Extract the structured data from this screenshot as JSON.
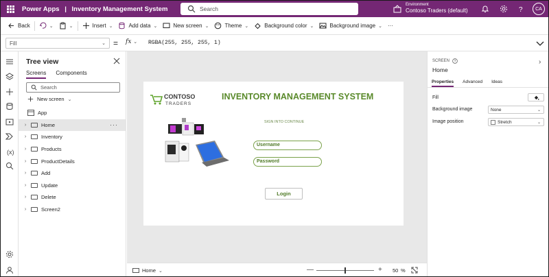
{
  "titlebar": {
    "product": "Power Apps",
    "separator": "|",
    "app_name": "Inventory Management System",
    "search_placeholder": "Search",
    "env_label": "Environment",
    "env_value": "Contoso Traders (default)",
    "avatar_initials": "CA"
  },
  "commandbar": {
    "back": "Back",
    "insert": "Insert",
    "add_data": "Add data",
    "new_screen": "New screen",
    "theme": "Theme",
    "background_color": "Background color",
    "background_image": "Background image",
    "more": "···"
  },
  "formulabar": {
    "property": "Fill",
    "equals": "=",
    "fx": "fx",
    "formula": "RGBA(255, 255, 255, 1)"
  },
  "tree": {
    "title": "Tree view",
    "tabs": [
      "Screens",
      "Components"
    ],
    "search_placeholder": "Search",
    "new_screen": "New screen",
    "app_item": "App",
    "items": [
      "Home",
      "Inventory",
      "Products",
      "ProductDetails",
      "Add",
      "Update",
      "Delete",
      "Screen2"
    ],
    "selected": "Home",
    "more": "···"
  },
  "canvas": {
    "logo_line1": "CONTOSO",
    "logo_line2": "TRADERS",
    "heading": "INVENTORY MANAGEMENT SYSTEM",
    "signin": "SIGN INTO CONTINUE",
    "username": "Username",
    "password": "Password",
    "login": "Login"
  },
  "bottombar": {
    "screen": "Home",
    "zoom": "50",
    "zoom_unit": "%",
    "zoom_level": 0.5
  },
  "properties": {
    "section": "SCREEN",
    "name": "Home",
    "tabs": [
      "Properties",
      "Advanced",
      "Ideas"
    ],
    "fill_label": "Fill",
    "bg_image_label": "Background image",
    "bg_image_value": "None",
    "img_pos_label": "Image position",
    "img_pos_value": "Stretch"
  },
  "colors": {
    "brand": "#742774",
    "heading": "#5a8a2b",
    "field_border": "#7aa14a"
  }
}
